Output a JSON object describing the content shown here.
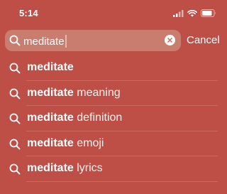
{
  "status_bar": {
    "time": "5:14",
    "icons": [
      "cellular-signal-icon",
      "wifi-icon",
      "battery-icon"
    ]
  },
  "search": {
    "value": "meditate",
    "cancel_label": "Cancel"
  },
  "suggestions": [
    {
      "query": "meditate",
      "completion": ""
    },
    {
      "query": "meditate",
      "completion": " meaning"
    },
    {
      "query": "meditate",
      "completion": " definition"
    },
    {
      "query": "meditate",
      "completion": " emoji"
    },
    {
      "query": "meditate",
      "completion": " lyrics"
    }
  ],
  "colors": {
    "background": "#bd4f47",
    "search_field": "#c97d6f",
    "text": "#ffffff"
  }
}
